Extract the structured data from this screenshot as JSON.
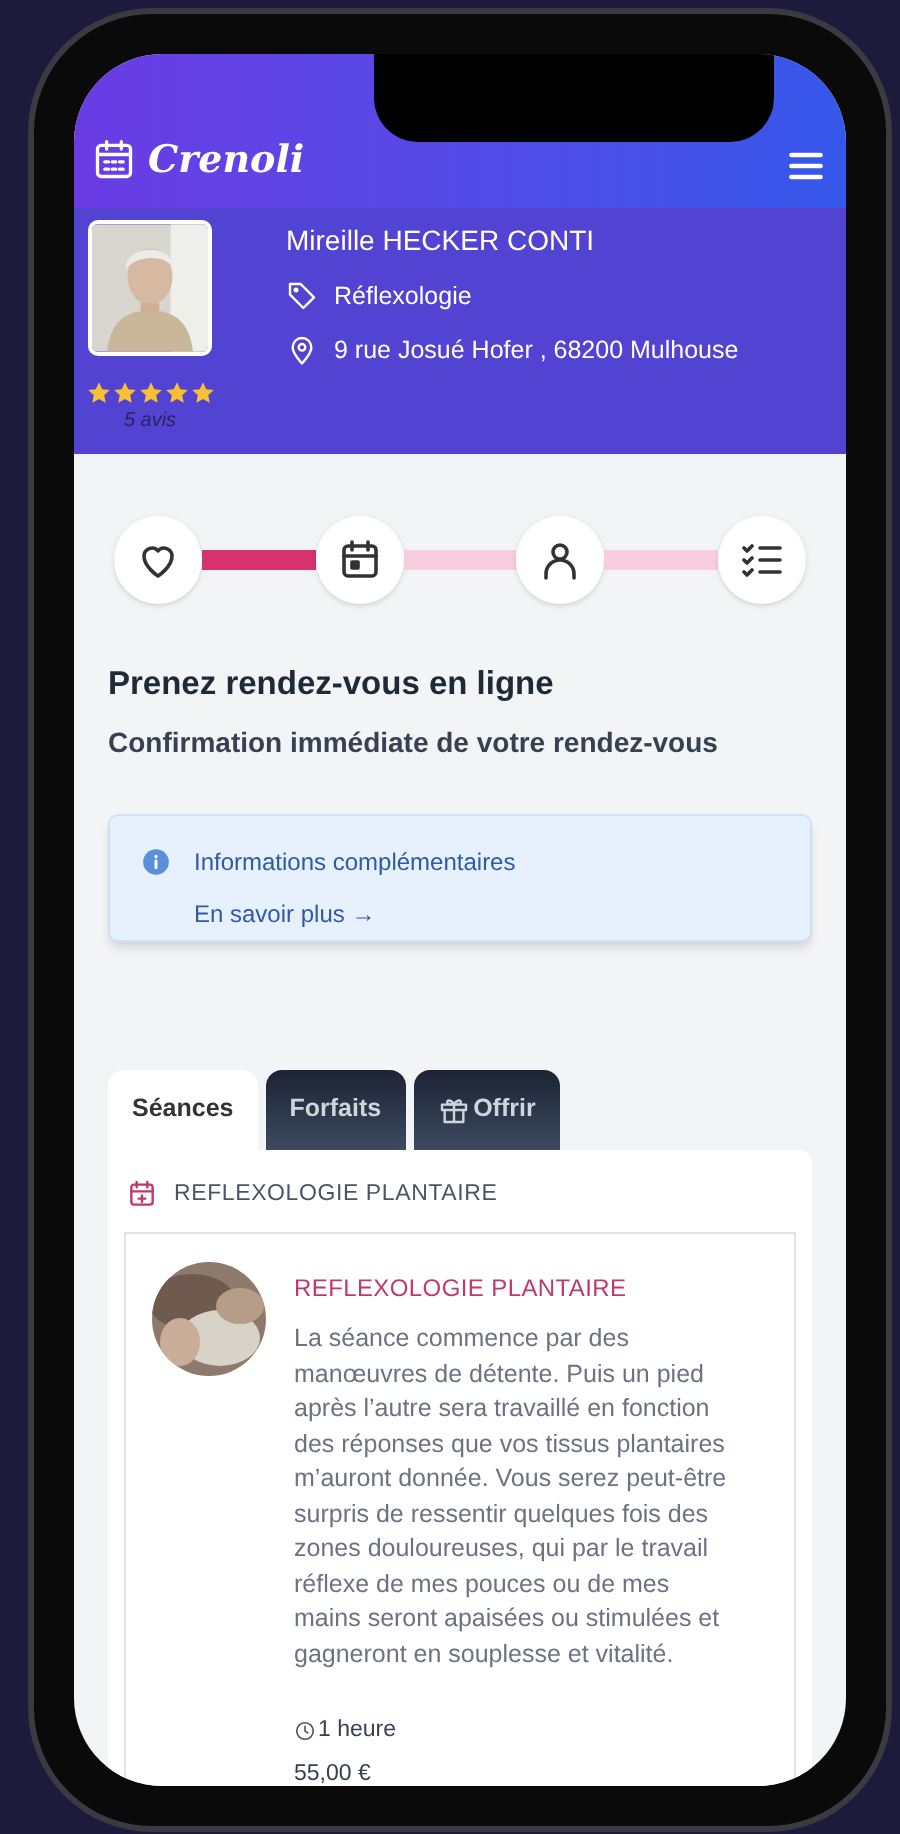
{
  "header": {
    "logo": "Crenoli"
  },
  "profile": {
    "name": "Mireille HECKER CONTI",
    "specialty": "Réflexologie",
    "address": "9 rue Josué Hofer , 68200 Mulhouse",
    "stars": 5,
    "reviews": "5 avis"
  },
  "steps": [
    {
      "kind": "heart"
    },
    {
      "kind": "calendar"
    },
    {
      "kind": "person"
    },
    {
      "kind": "checklist"
    }
  ],
  "connectors": [
    {
      "completed": true
    },
    {
      "completed": false
    },
    {
      "completed": false
    }
  ],
  "heading": "Prenez rendez-vous en ligne",
  "subheading": "Confirmation immédiate de votre rendez-vous",
  "info": {
    "title": "Informations complémentaires",
    "link": "En savoir plus →"
  },
  "tabs": [
    {
      "label": "Séances",
      "selected": true,
      "kind": "plain"
    },
    {
      "label": "Forfaits",
      "selected": false,
      "kind": "plain"
    },
    {
      "label": "Offrir",
      "selected": false,
      "kind": "gift"
    }
  ],
  "section": {
    "title": "REFLEXOLOGIE PLANTAIRE"
  },
  "service": {
    "title": "REFLEXOLOGIE PLANTAIRE",
    "description": "La séance commence par des manœuvres de détente. Puis un pied après l’autre sera travaillé en fonction des réponses que vos tissus plantaires m’auront donnée. Vous serez peut-être surpris de ressentir quelques fois des zones douloureuses, qui par le travail réflexe de mes pouces ou de mes mains seront apaisées ou stimulées et gagneront en souplesse et vitalité.",
    "duration": "1 heure",
    "price": "55,00 €"
  }
}
